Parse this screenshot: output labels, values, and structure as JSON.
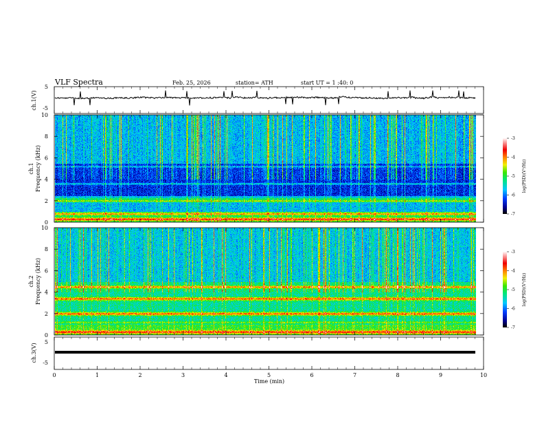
{
  "header": {
    "title": "VLF  Spectra",
    "date": "Feb. 25, 2026",
    "station": "station= ATH",
    "start_ut": "start  UT  =   1 :40: 0"
  },
  "chart_data": [
    {
      "type": "line",
      "name": "ch1-waveform",
      "ylabel": "ch.1(V)",
      "ylim": [
        -5,
        5
      ],
      "yticks": [
        "5",
        "-5"
      ],
      "xlim": [
        0,
        10
      ],
      "color": "#000000"
    },
    {
      "type": "heatmap",
      "name": "ch1-spectrogram",
      "ylabel_top": "ch.1",
      "ylabel_bottom": "Frequency (kHz)",
      "ylim": [
        0,
        10
      ],
      "yticks": [
        "0",
        "2",
        "4",
        "6",
        "8",
        "10"
      ],
      "xlim": [
        0,
        10
      ],
      "colorbar": {
        "label": "log(PSD)(V²/Hz)",
        "range": [
          -7,
          -3
        ],
        "ticks": [
          "-3",
          "-4",
          "-5",
          "-6",
          "-7"
        ]
      }
    },
    {
      "type": "heatmap",
      "name": "ch2-spectrogram",
      "ylabel_top": "ch.2",
      "ylabel_bottom": "Frequency (kHz)",
      "ylim": [
        0,
        10
      ],
      "yticks": [
        "0",
        "2",
        "4",
        "6",
        "8",
        "10"
      ],
      "xlim": [
        0,
        10
      ],
      "colorbar": {
        "label": "log(PSD)(V²/Hz)",
        "range": [
          -7,
          -3
        ],
        "ticks": [
          "-3",
          "-4",
          "-5",
          "-6",
          "-7"
        ]
      }
    },
    {
      "type": "line",
      "name": "ch3-waveform",
      "ylabel": "ch.3(V)",
      "ylim": [
        -5,
        5
      ],
      "yticks": [
        "5",
        "-5"
      ],
      "xlim": [
        0,
        10
      ],
      "xlabel": "Time  (min)",
      "xticks": [
        "0",
        "1",
        "2",
        "3",
        "4",
        "5",
        "6",
        "7",
        "8",
        "9",
        "10"
      ],
      "color": "#000000"
    }
  ]
}
